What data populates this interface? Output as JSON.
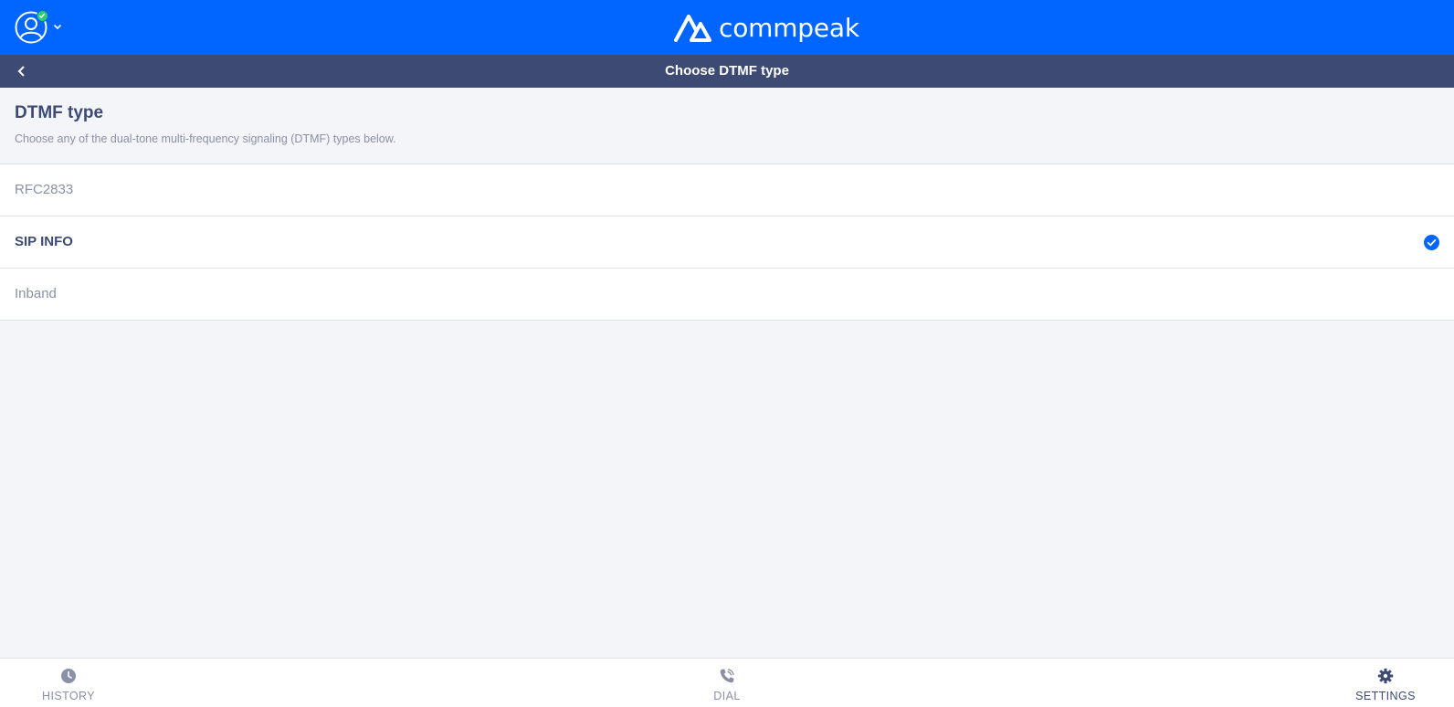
{
  "header": {
    "logo_text": "commpeak",
    "avatar_icon": "user-avatar-icon",
    "status": "online",
    "status_color": "#2ecc71",
    "chevron_icon": "chevron-down-icon",
    "brand_color": "#0066ff"
  },
  "subheader": {
    "title": "Choose DTMF type",
    "back_icon": "chevron-left-icon",
    "color": "#3d4a73"
  },
  "section": {
    "title": "DTMF type",
    "description": "Choose any of the dual-tone multi-frequency signaling (DTMF) types below."
  },
  "options": [
    {
      "label": "RFC2833",
      "selected": false
    },
    {
      "label": "SIP INFO",
      "selected": true
    },
    {
      "label": "Inband",
      "selected": false
    }
  ],
  "bottom_nav": {
    "history": {
      "label": "HISTORY",
      "icon": "clock-icon",
      "active": false
    },
    "dial": {
      "label": "DIAL",
      "icon": "phone-icon",
      "active": false
    },
    "settings": {
      "label": "SETTINGS",
      "icon": "gear-icon",
      "active": true
    }
  }
}
